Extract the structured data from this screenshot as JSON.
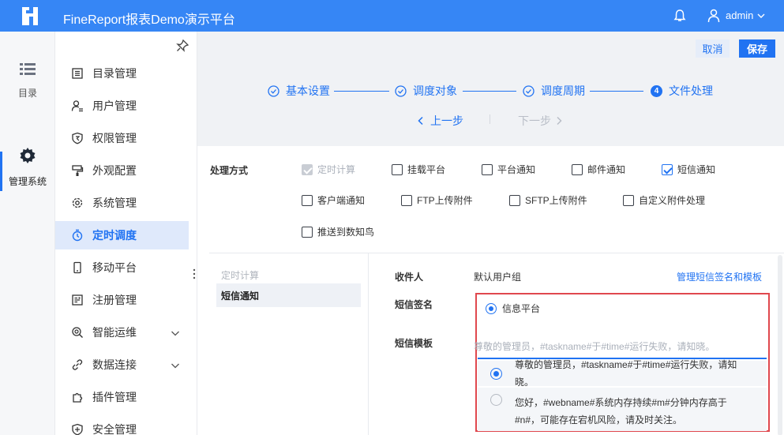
{
  "header": {
    "app_title": "FineReport报表Demo演示平台",
    "user_name": "admin"
  },
  "rail": {
    "catalog_label": "目录",
    "admin_label": "管理系统"
  },
  "menu": {
    "items": [
      {
        "label": "目录管理",
        "icon": "catalog-icon"
      },
      {
        "label": "用户管理",
        "icon": "user-icon"
      },
      {
        "label": "权限管理",
        "icon": "shield-icon"
      },
      {
        "label": "外观配置",
        "icon": "paint-icon"
      },
      {
        "label": "系统管理",
        "icon": "gear-icon"
      },
      {
        "label": "定时调度",
        "icon": "timer-icon",
        "active": true
      },
      {
        "label": "移动平台",
        "icon": "mobile-icon"
      },
      {
        "label": "注册管理",
        "icon": "register-icon"
      },
      {
        "label": "智能运维",
        "icon": "ops-icon",
        "expandable": true
      },
      {
        "label": "数据连接",
        "icon": "link-icon",
        "expandable": true
      },
      {
        "label": "插件管理",
        "icon": "plugin-icon"
      },
      {
        "label": "安全管理",
        "icon": "security-icon"
      }
    ]
  },
  "toolbar": {
    "cancel_label": "取消",
    "save_label": "保存"
  },
  "steps": {
    "items": [
      "基本设置",
      "调度对象",
      "调度周期",
      "文件处理"
    ],
    "current_number": "4",
    "prev_label": "上一步",
    "next_label": "下一步"
  },
  "processing": {
    "title": "处理方式",
    "options": [
      {
        "label": "定时计算",
        "checked": true,
        "disabled": true
      },
      {
        "label": "挂载平台",
        "checked": false
      },
      {
        "label": "平台通知",
        "checked": false
      },
      {
        "label": "邮件通知",
        "checked": false
      },
      {
        "label": "短信通知",
        "checked": true
      },
      {
        "label": "客户端通知",
        "checked": false
      },
      {
        "label": "FTP上传附件",
        "checked": false
      },
      {
        "label": "SFTP上传附件",
        "checked": false
      },
      {
        "label": "自定义附件处理",
        "checked": false
      },
      {
        "label": "推送到数知鸟",
        "checked": false
      }
    ]
  },
  "sub_tabs": {
    "muted": "定时计算",
    "active": "短信通知"
  },
  "sms": {
    "recipient_label": "收件人",
    "recipient_value": "默认用户组",
    "manage_link": "管理短信签名和模板",
    "signature_label": "短信签名",
    "signature_option": "信息平台",
    "template_label": "短信模板",
    "template_placeholder": "尊敬的管理员，#taskname#于#time#运行失败，请知晓。",
    "template_options": [
      "尊敬的管理员，#taskname#于#time#运行失败，请知晓。",
      "您好，#webname#系统内存持续#m#分钟内存高于#n#，可能存在宕机风险，请及时关注。"
    ]
  },
  "colors": {
    "brand": "#3686f5",
    "accent": "#2173f2",
    "highlight_border": "#e0484e"
  }
}
